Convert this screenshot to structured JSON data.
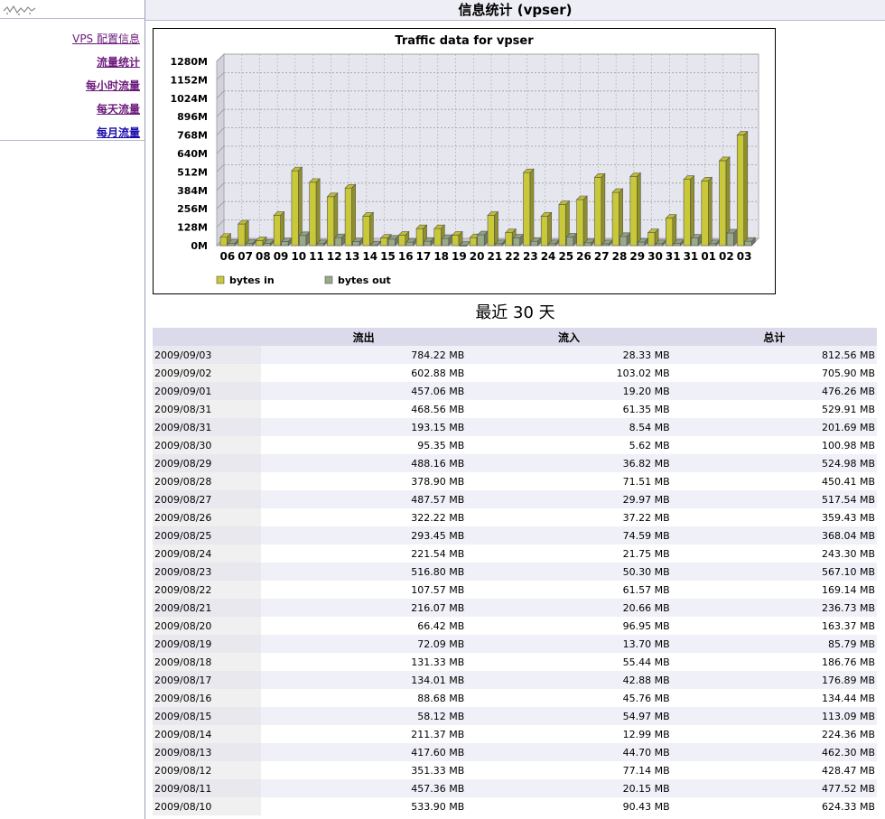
{
  "page": {
    "title": "信息统计 (vpser)"
  },
  "sidebar": {
    "items": [
      {
        "label": "VPS 配置信息",
        "visited": true
      },
      {
        "label": "流量统计",
        "visited": true
      },
      {
        "label": "每小时流量",
        "visited": true
      },
      {
        "label": "每天流量",
        "visited": true
      },
      {
        "label": "每月流量",
        "visited": false
      }
    ]
  },
  "chart_data": {
    "type": "bar",
    "title": "Traffic data for vpser",
    "categories": [
      "06",
      "07",
      "08",
      "09",
      "10",
      "11",
      "12",
      "13",
      "14",
      "15",
      "16",
      "17",
      "18",
      "19",
      "20",
      "21",
      "22",
      "23",
      "24",
      "25",
      "26",
      "27",
      "28",
      "29",
      "30",
      "31",
      "31",
      "01",
      "02",
      "03"
    ],
    "yticks": [
      "0M",
      "128M",
      "256M",
      "384M",
      "512M",
      "640M",
      "768M",
      "896M",
      "1024M",
      "1152M",
      "1280M"
    ],
    "ylim": [
      0,
      1280
    ],
    "series": [
      {
        "name": "bytes in",
        "color": "#c8c838",
        "values": [
          58,
          150,
          34,
          210,
          520,
          440,
          340,
          400,
          205,
          52,
          72,
          118,
          118,
          72,
          55,
          210,
          90,
          507,
          205,
          285,
          320,
          475,
          370,
          480,
          90,
          190,
          460,
          450,
          590,
          768
        ]
      },
      {
        "name": "bytes out",
        "color": "#9aaa88",
        "values": [
          15,
          15,
          15,
          28,
          70,
          14,
          55,
          28,
          5,
          45,
          24,
          30,
          50,
          2,
          75,
          14,
          53,
          30,
          14,
          60,
          20,
          13,
          64,
          25,
          14,
          15,
          52,
          14,
          88,
          30
        ]
      }
    ],
    "legend": "bottom",
    "grid": true
  },
  "section": {
    "title": "最近 30 天"
  },
  "table": {
    "headers": [
      "",
      "流出",
      "流入",
      "总计"
    ],
    "rows": [
      [
        "2009/09/03",
        "784.22 MB",
        "28.33 MB",
        "812.56 MB"
      ],
      [
        "2009/09/02",
        "602.88 MB",
        "103.02 MB",
        "705.90 MB"
      ],
      [
        "2009/09/01",
        "457.06 MB",
        "19.20 MB",
        "476.26 MB"
      ],
      [
        "2009/08/31",
        "468.56 MB",
        "61.35 MB",
        "529.91 MB"
      ],
      [
        "2009/08/31",
        "193.15 MB",
        "8.54 MB",
        "201.69 MB"
      ],
      [
        "2009/08/30",
        "95.35 MB",
        "5.62 MB",
        "100.98 MB"
      ],
      [
        "2009/08/29",
        "488.16 MB",
        "36.82 MB",
        "524.98 MB"
      ],
      [
        "2009/08/28",
        "378.90 MB",
        "71.51 MB",
        "450.41 MB"
      ],
      [
        "2009/08/27",
        "487.57 MB",
        "29.97 MB",
        "517.54 MB"
      ],
      [
        "2009/08/26",
        "322.22 MB",
        "37.22 MB",
        "359.43 MB"
      ],
      [
        "2009/08/25",
        "293.45 MB",
        "74.59 MB",
        "368.04 MB"
      ],
      [
        "2009/08/24",
        "221.54 MB",
        "21.75 MB",
        "243.30 MB"
      ],
      [
        "2009/08/23",
        "516.80 MB",
        "50.30 MB",
        "567.10 MB"
      ],
      [
        "2009/08/22",
        "107.57 MB",
        "61.57 MB",
        "169.14 MB"
      ],
      [
        "2009/08/21",
        "216.07 MB",
        "20.66 MB",
        "236.73 MB"
      ],
      [
        "2009/08/20",
        "66.42 MB",
        "96.95 MB",
        "163.37 MB"
      ],
      [
        "2009/08/19",
        "72.09 MB",
        "13.70 MB",
        "85.79 MB"
      ],
      [
        "2009/08/18",
        "131.33 MB",
        "55.44 MB",
        "186.76 MB"
      ],
      [
        "2009/08/17",
        "134.01 MB",
        "42.88 MB",
        "176.89 MB"
      ],
      [
        "2009/08/16",
        "88.68 MB",
        "45.76 MB",
        "134.44 MB"
      ],
      [
        "2009/08/15",
        "58.12 MB",
        "54.97 MB",
        "113.09 MB"
      ],
      [
        "2009/08/14",
        "211.37 MB",
        "12.99 MB",
        "224.36 MB"
      ],
      [
        "2009/08/13",
        "417.60 MB",
        "44.70 MB",
        "462.30 MB"
      ],
      [
        "2009/08/12",
        "351.33 MB",
        "77.14 MB",
        "428.47 MB"
      ],
      [
        "2009/08/11",
        "457.36 MB",
        "20.15 MB",
        "477.52 MB"
      ],
      [
        "2009/08/10",
        "533.90 MB",
        "90.43 MB",
        "624.33 MB"
      ]
    ]
  }
}
